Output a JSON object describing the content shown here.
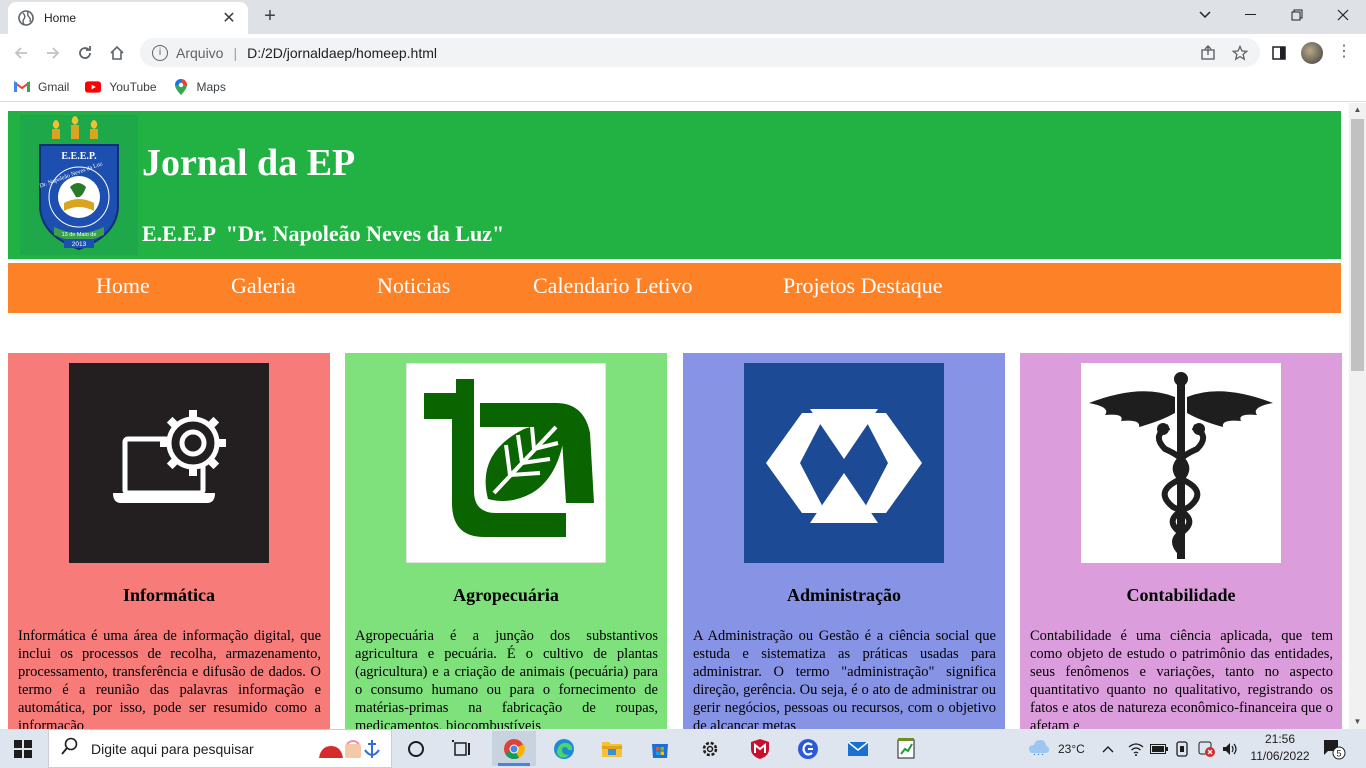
{
  "browser": {
    "tab_title": "Home",
    "tab_close": "✕",
    "new_tab": "+",
    "protocol_label": "Arquivo",
    "address": "D:/2D/jornaldaep/homeep.html",
    "bookmarks": [
      {
        "label": "Gmail",
        "icon": "gmail-icon"
      },
      {
        "label": "YouTube",
        "icon": "youtube-icon"
      },
      {
        "label": "Maps",
        "icon": "maps-icon"
      }
    ]
  },
  "site": {
    "title": "Jornal da EP",
    "subtitle": "E.E.E.P  \"Dr. Napoleão Neves da Luz\"",
    "logo_text": {
      "top": "E.E.E.P.",
      "ring": "Dr. Napoleão Neves da Luz",
      "date": "13 de Maio de",
      "year": "2013"
    },
    "nav": [
      "Home",
      "Galeria",
      "Noticias",
      "Calendario Letivo",
      "Projetos Destaque"
    ]
  },
  "cards": [
    {
      "title": "Informática",
      "icon": "computer-gear-icon",
      "bg": "#f77c79",
      "icon_bg": "#231f20",
      "text": "Informática é uma área de informação digital, que inclui os processos de recolha, armazenamento, processamento, transferência e difusão de dados. O termo é a reunião das palavras informação e automática, por isso, pode ser resumido como a informação"
    },
    {
      "title": "Agropecuária",
      "icon": "leaf-logo-icon",
      "bg": "#7fe17b",
      "icon_bg": "#ffffff",
      "text": "Agropecuária é a junção dos substantivos agricultura e pecuária. É o cultivo de plantas (agricultura) e a criação de animais (pecuária) para o consumo humano ou para o fornecimento de matérias-primas na fabricação de roupas, medicamentos, biocombustíveis"
    },
    {
      "title": "Administração",
      "icon": "admin-logo-icon",
      "bg": "#8794e6",
      "icon_bg": "#1c4a94",
      "text": "A Administração ou Gestão é a ciência social que estuda e sistematiza as práticas usadas para administrar. O termo \"administração\" significa direção, gerência. Ou seja, é o ato de administrar ou gerir negócios, pessoas ou recursos, com o objetivo de alcançar metas"
    },
    {
      "title": "Contabilidade",
      "icon": "caduceus-icon",
      "bg": "#dc9ddd",
      "icon_bg": "#ffffff",
      "text": "Contabilidade é uma ciência aplicada, que tem como objeto de estudo o patrimônio das entidades, seus fenômenos e variações, tanto no aspecto quantitativo quanto no qualitativo, registrando os fatos e atos de natureza econômico-financeira que o afetam e"
    }
  ],
  "taskbar": {
    "search_placeholder": "Digite aqui para pesquisar",
    "weather": "23°C",
    "time": "21:56",
    "date": "11/06/2022",
    "notifications": "5"
  }
}
